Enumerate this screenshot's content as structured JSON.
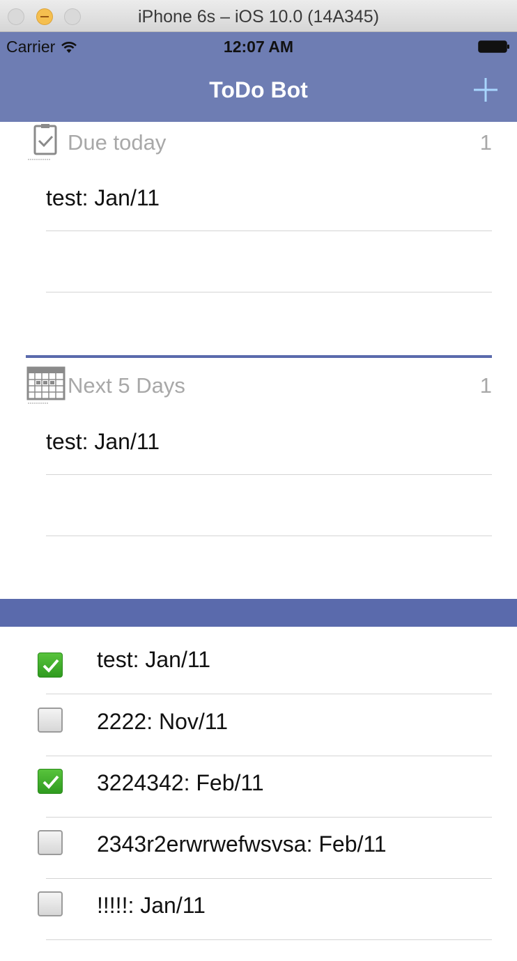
{
  "window": {
    "title": "iPhone 6s – iOS 10.0 (14A345)"
  },
  "status_bar": {
    "carrier": "Carrier",
    "time": "12:07 AM"
  },
  "nav": {
    "title": "ToDo Bot",
    "add_icon": "plus-icon"
  },
  "due_today": {
    "icon": "clipboard-check-icon",
    "title": "Due today",
    "count": "1",
    "rows": [
      "test: Jan/11",
      ""
    ]
  },
  "next_days": {
    "icon": "calendar-icon",
    "title": "Next 5 Days",
    "count": "1",
    "rows": [
      "test: Jan/11",
      ""
    ]
  },
  "tasks": [
    {
      "text": "test: Jan/11",
      "done": true
    },
    {
      "text": "2222: Nov/11",
      "done": false
    },
    {
      "text": "3224342: Feb/11",
      "done": true
    },
    {
      "text": "2343r2erwrwefwsvsa: Feb/11",
      "done": false
    },
    {
      "text": "!!!!!: Jan/11",
      "done": false
    }
  ],
  "colors": {
    "nav": "#6e7db3",
    "accent": "#5a6aac",
    "check": "#34a124"
  }
}
